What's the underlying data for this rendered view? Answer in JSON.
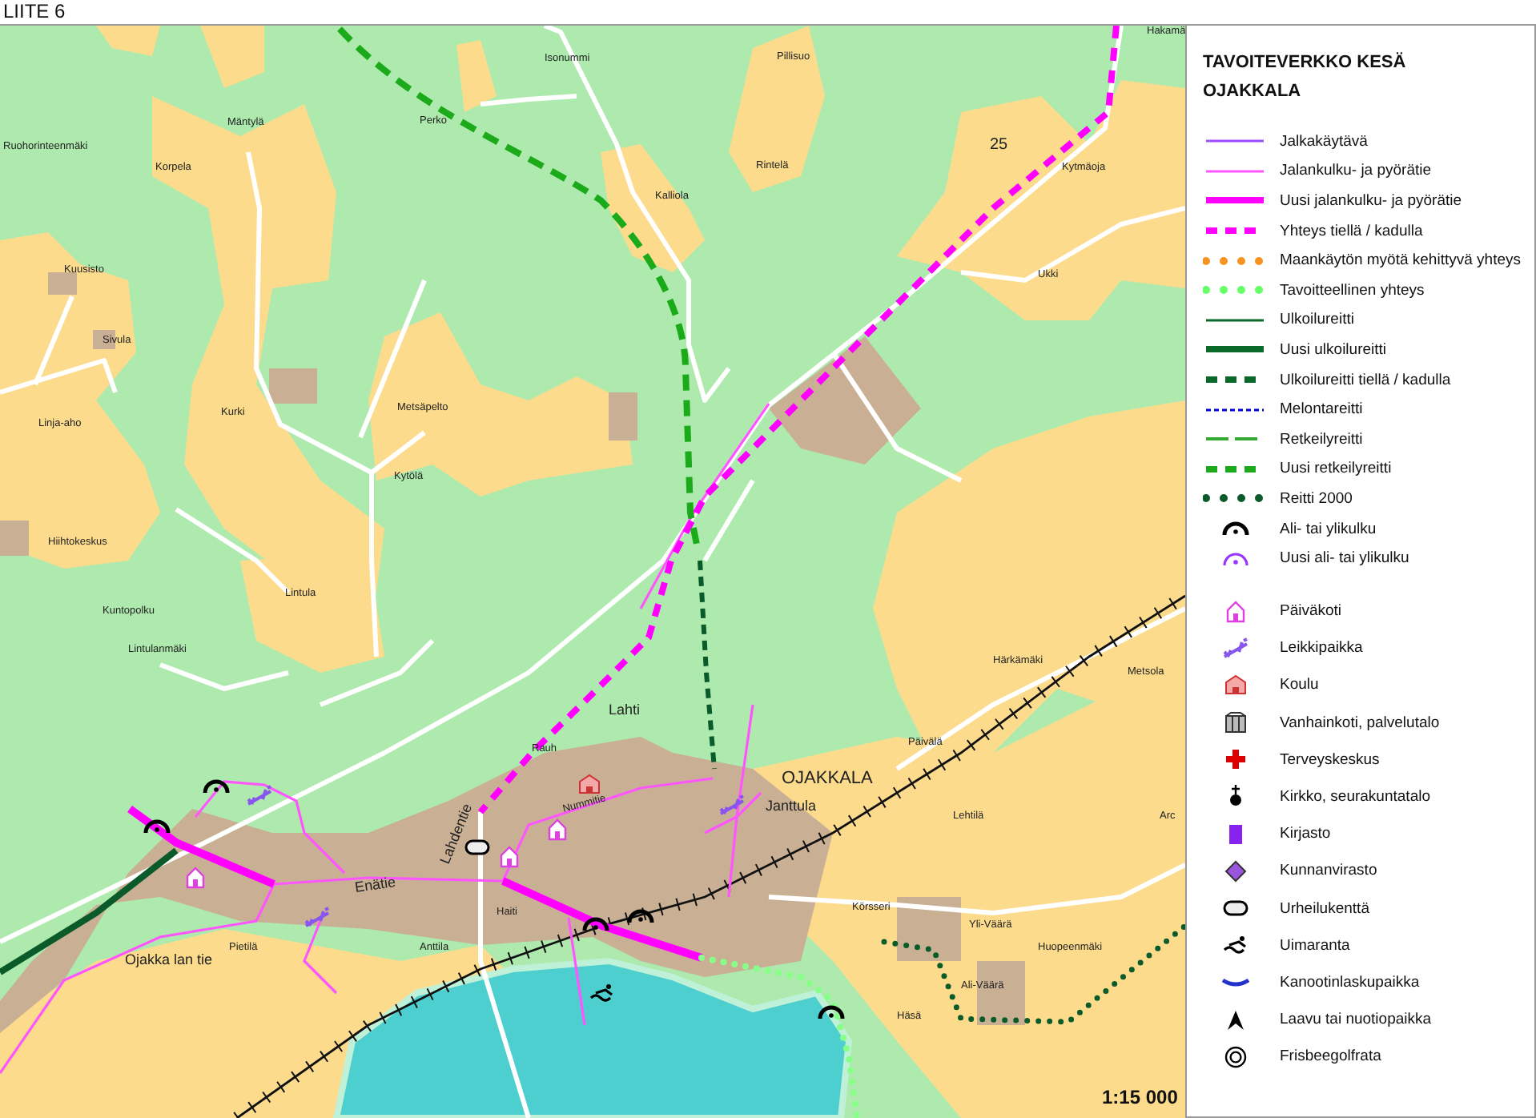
{
  "header": {
    "title": "LIITE 6"
  },
  "map": {
    "labels": [
      {
        "text": "Isonummi",
        "kind": "place"
      },
      {
        "text": "Pillisuo",
        "kind": "place"
      },
      {
        "text": "Hakamä",
        "kind": "place"
      },
      {
        "text": "Mäntylä",
        "kind": "place"
      },
      {
        "text": "Perko",
        "kind": "place"
      },
      {
        "text": "Ruohorinteenmäki",
        "kind": "place"
      },
      {
        "text": "Korpela",
        "kind": "place"
      },
      {
        "text": "Rintelä",
        "kind": "place"
      },
      {
        "text": "25",
        "kind": "number"
      },
      {
        "text": "Kytmäoja",
        "kind": "place"
      },
      {
        "text": "Kalliola",
        "kind": "place"
      },
      {
        "text": "Kuusisto",
        "kind": "place"
      },
      {
        "text": "Ukki",
        "kind": "place"
      },
      {
        "text": "Sivula",
        "kind": "place"
      },
      {
        "text": "Kurki",
        "kind": "place"
      },
      {
        "text": "Metsäpelto",
        "kind": "place"
      },
      {
        "text": "Linja-aho",
        "kind": "place"
      },
      {
        "text": "Kytölä",
        "kind": "place"
      },
      {
        "text": "Hiihtokeskus",
        "kind": "place"
      },
      {
        "text": "Lintula",
        "kind": "place"
      },
      {
        "text": "Kuntopolku",
        "kind": "place"
      },
      {
        "text": "Lintulanmäki",
        "kind": "place"
      },
      {
        "text": "Härkämäki",
        "kind": "place"
      },
      {
        "text": "Metsola",
        "kind": "place"
      },
      {
        "text": "Lahti",
        "kind": "road"
      },
      {
        "text": "Rauh",
        "kind": "place"
      },
      {
        "text": "Päivälä",
        "kind": "place"
      },
      {
        "text": "OJAKKALA",
        "kind": "village"
      },
      {
        "text": "Janttula",
        "kind": "road"
      },
      {
        "text": "Lehtilä",
        "kind": "place"
      },
      {
        "text": "Arc",
        "kind": "place"
      },
      {
        "text": "Nummitie",
        "kind": "place"
      },
      {
        "text": "Lahdentie",
        "kind": "road"
      },
      {
        "text": "Enätie",
        "kind": "road"
      },
      {
        "text": "Körsseri",
        "kind": "place"
      },
      {
        "text": "Yli-Väärä",
        "kind": "place"
      },
      {
        "text": "Huopeenmäki",
        "kind": "place"
      },
      {
        "text": "Ojakka lan tie",
        "kind": "road"
      },
      {
        "text": "Pietilä",
        "kind": "place"
      },
      {
        "text": "Haiti",
        "kind": "place"
      },
      {
        "text": "Anttila",
        "kind": "place"
      },
      {
        "text": "Ali-Väärä",
        "kind": "place"
      },
      {
        "text": "Häsä",
        "kind": "place"
      }
    ],
    "scale": "1:15 000"
  },
  "legend": {
    "title": "TAVOITEVERKKO KESÄ",
    "subtitle": "OJAKKALA",
    "items": [
      {
        "label": "Jalkakäytävä",
        "kind": "line",
        "color": "#9b4dff"
      },
      {
        "label": "Jalankulku- ja pyörätie",
        "kind": "line",
        "color": "#ff55ff"
      },
      {
        "label": "Uusi jalankulku- ja pyörätie",
        "kind": "thick-line",
        "color": "#ff00ff"
      },
      {
        "label": "Yhteys tiellä / kadulla",
        "kind": "dashed",
        "color": "#ff00ff"
      },
      {
        "label": "Maankäytön myötä kehittyvä yhteys",
        "kind": "dotted",
        "color": "#f7931e"
      },
      {
        "label": "Tavoitteellinen yhteys",
        "kind": "dotted",
        "color": "#66ff66"
      },
      {
        "label": "Ulkoilureitti",
        "kind": "line",
        "color": "#0a6a2a"
      },
      {
        "label": "Uusi ulkoilureitti",
        "kind": "thick-line",
        "color": "#0a6a2a"
      },
      {
        "label": "Ulkoilureitti tiellä / kadulla",
        "kind": "dashed",
        "color": "#0a6a2a"
      },
      {
        "label": "Melontareitti",
        "kind": "fine-dashed",
        "color": "#0000cc"
      },
      {
        "label": "Retkeilyreitti",
        "kind": "long-dashed",
        "color": "#33aa33"
      },
      {
        "label": "Uusi retkeilyreitti",
        "kind": "dashed",
        "color": "#1aaa1a"
      },
      {
        "label": "Reitti 2000",
        "kind": "dotted",
        "color": "#0a5a2a"
      },
      {
        "label": "Ali- tai ylikulku",
        "kind": "underpass"
      },
      {
        "label": "Uusi ali- tai ylikulku",
        "kind": "new-underpass"
      },
      {
        "label": "Päiväkoti",
        "kind": "daycare"
      },
      {
        "label": "Leikkipaikka",
        "kind": "playground"
      },
      {
        "label": "Koulu",
        "kind": "school"
      },
      {
        "label": "Vanhainkoti, palvelutalo",
        "kind": "care-home"
      },
      {
        "label": "Terveyskeskus",
        "kind": "health-centre"
      },
      {
        "label": "Kirkko, seurakuntatalo",
        "kind": "church"
      },
      {
        "label": "Kirjasto",
        "kind": "library"
      },
      {
        "label": "Kunnanvirasto",
        "kind": "municipal-office"
      },
      {
        "label": "Urheilukenttä",
        "kind": "sports-field"
      },
      {
        "label": "Uimaranta",
        "kind": "beach"
      },
      {
        "label": "Kanootinlaskupaikka",
        "kind": "canoe-launch"
      },
      {
        "label": "Laavu tai nuotiopaikka",
        "kind": "shelter"
      },
      {
        "label": "Frisbeegolfrata",
        "kind": "disc-golf"
      }
    ]
  }
}
